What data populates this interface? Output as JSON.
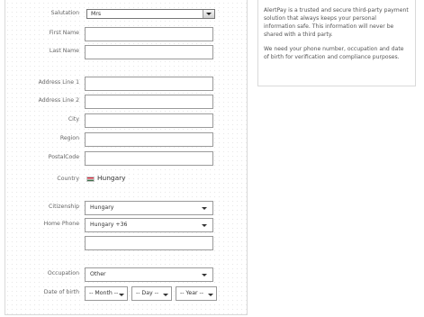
{
  "form": {
    "salutation": {
      "label": "Salutation",
      "value": "Mrs"
    },
    "first_name": {
      "label": "First Name",
      "value": ""
    },
    "last_name": {
      "label": "Last Name",
      "value": ""
    },
    "address_line_1": {
      "label": "Address Line 1",
      "value": ""
    },
    "address_line_2": {
      "label": "Address Line 2",
      "value": ""
    },
    "city": {
      "label": "City",
      "value": ""
    },
    "region": {
      "label": "Region",
      "value": ""
    },
    "postal_code": {
      "label": "PostalCode",
      "value": ""
    },
    "country": {
      "label": "Country",
      "value": "Hungary"
    },
    "citizenship": {
      "label": "Citizenship",
      "value": "Hungary"
    },
    "home_phone": {
      "label": "Home Phone",
      "code_value": "Hungary +36",
      "number_value": ""
    },
    "occupation": {
      "label": "Occupation",
      "value": "Other"
    },
    "date_of_birth": {
      "label": "Date of birth",
      "month": "-- Month --",
      "day": "-- Day --",
      "year": "-- Year --"
    }
  },
  "info": {
    "paragraph_1": "AlertPay is a trusted and secure third-party payment solution that always keeps your personal information safe. This information will never be shared with a third party.",
    "paragraph_2": "We need your phone number, occupation and date of birth for verification and compliance purposes."
  },
  "colors": {
    "flag_red": "#cd2a3e",
    "flag_white": "#ffffff",
    "flag_green": "#436f4d"
  },
  "icons": {
    "dropdown": "chevron-down-icon",
    "flag": "hungary-flag-icon"
  }
}
